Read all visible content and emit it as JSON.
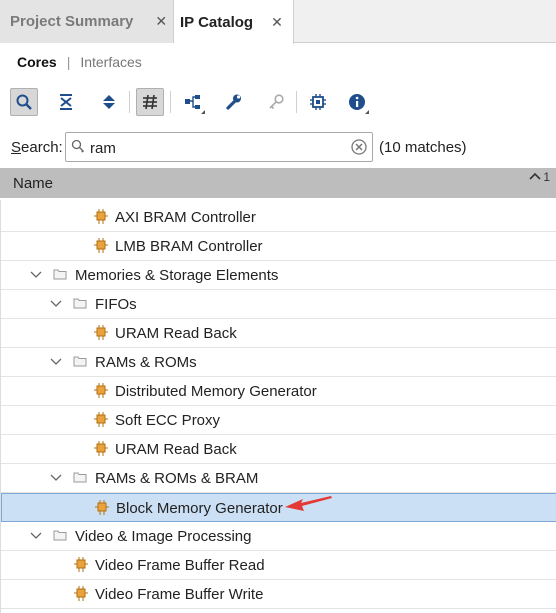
{
  "tabs": [
    {
      "label": "Project Summary",
      "active": false
    },
    {
      "label": "IP Catalog",
      "active": true
    }
  ],
  "subtabs": {
    "cores": "Cores",
    "interfaces": "Interfaces"
  },
  "toolbar": {
    "buttons": [
      "search-icon",
      "collapse-all-icon",
      "expand-all-icon",
      "filter-icon",
      "hierarchy-icon",
      "wrench-icon",
      "key-icon",
      "chip-icon",
      "info-icon"
    ]
  },
  "search": {
    "label_prefix": "S",
    "label_rest": "earch:",
    "value": "ram",
    "matches": "(10 matches)"
  },
  "header": {
    "name": "Name",
    "sort_index": "1"
  },
  "tree": [
    {
      "label": "AXI BRAM Controller",
      "type": "core",
      "level": 3
    },
    {
      "label": "LMB BRAM Controller",
      "type": "core",
      "level": 3
    },
    {
      "label": "Memories & Storage Elements",
      "type": "folder",
      "level": 1
    },
    {
      "label": "FIFOs",
      "type": "folder",
      "level": 2
    },
    {
      "label": "URAM Read Back",
      "type": "core",
      "level": 3
    },
    {
      "label": "RAMs & ROMs",
      "type": "folder",
      "level": 2
    },
    {
      "label": "Distributed Memory Generator",
      "type": "core",
      "level": 3
    },
    {
      "label": "Soft ECC Proxy",
      "type": "core",
      "level": 3
    },
    {
      "label": "URAM Read Back",
      "type": "core",
      "level": 3
    },
    {
      "label": "RAMs & ROMs & BRAM",
      "type": "folder",
      "level": 2
    },
    {
      "label": "Block Memory Generator",
      "type": "core",
      "level": 3,
      "selected": true
    },
    {
      "label": "Video & Image Processing",
      "type": "folder",
      "level": 1
    },
    {
      "label": "Video Frame Buffer Read",
      "type": "core",
      "level": 2
    },
    {
      "label": "Video Frame Buffer Write",
      "type": "core",
      "level": 2
    }
  ],
  "colors": {
    "selection": "#cce0f5",
    "header": "#bdbdbd",
    "core_icon": "#e8a33c",
    "arrow": "#e53935"
  }
}
